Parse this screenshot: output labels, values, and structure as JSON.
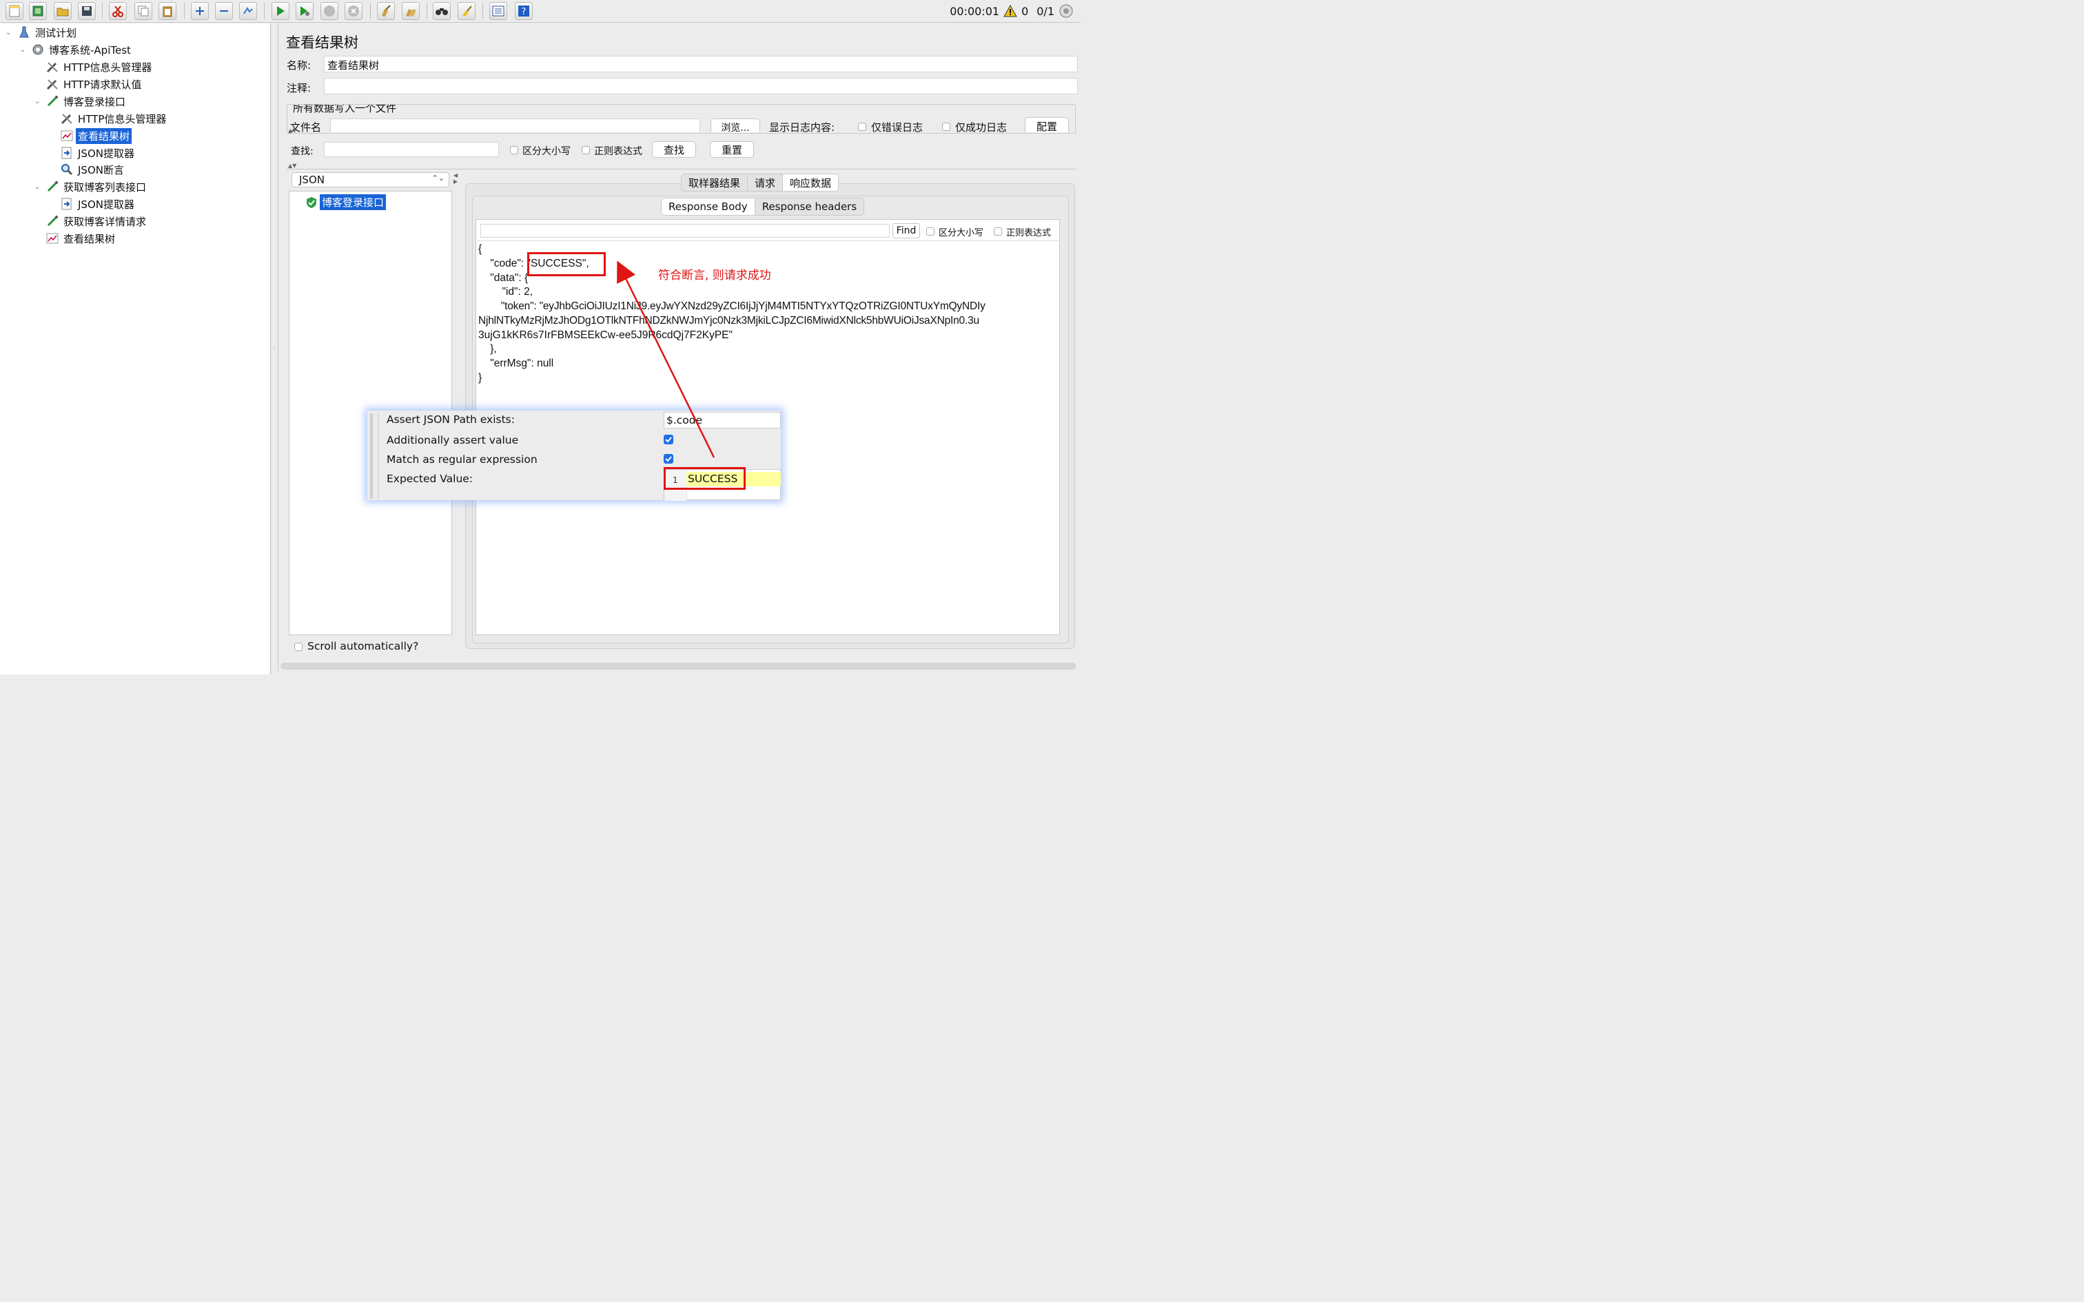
{
  "toolbar": {
    "icons": [
      "new-icon",
      "templates-icon",
      "open-icon",
      "save-icon",
      "cut-icon",
      "copy-icon",
      "paste-icon",
      "expand-icon",
      "collapse-icon",
      "toggle-icon",
      "start-icon",
      "start-no-pause-icon",
      "stop-icon",
      "shutdown-icon",
      "clear-icon",
      "clear-all-icon",
      "search-icon",
      "reset-search-icon",
      "function-helper-icon",
      "help-icon"
    ],
    "timer": "00:00:01",
    "warning_count": "0",
    "threads": "0/1"
  },
  "tree": {
    "items": [
      {
        "label": "测试计划",
        "icon": "flask-icon"
      },
      {
        "label": "博客系统-ApiTest",
        "icon": "gear-icon"
      },
      {
        "label": "HTTP信息头管理器",
        "icon": "wrench-icon"
      },
      {
        "label": "HTTP请求默认值",
        "icon": "wrench-icon"
      },
      {
        "label": "博客登录接口",
        "icon": "pipette-icon"
      },
      {
        "label": "HTTP信息头管理器",
        "icon": "wrench-icon"
      },
      {
        "label": "查看结果树",
        "icon": "chart-icon"
      },
      {
        "label": "JSON提取器",
        "icon": "extractor-icon"
      },
      {
        "label": "JSON断言",
        "icon": "magnifier-icon"
      },
      {
        "label": "获取博客列表接口",
        "icon": "pipette-icon"
      },
      {
        "label": "JSON提取器",
        "icon": "extractor-icon"
      },
      {
        "label": "获取博客详情请求",
        "icon": "pipette-icon"
      },
      {
        "label": "查看结果树",
        "icon": "chart-icon"
      }
    ]
  },
  "panel": {
    "title": "查看结果树",
    "name_label": "名称:",
    "name_value": "查看结果树",
    "comment_label": "注释:",
    "comment_value": "",
    "file_section_title": "所有数据写入一个文件",
    "filename_label": "文件名",
    "browse_button": "浏览...",
    "log_display_label": "显示日志内容:",
    "errors_only_label": "仅错误日志",
    "success_only_label": "仅成功日志",
    "configure_button": "配置",
    "search_label": "查找:",
    "search_value": "",
    "case_sensitive_label": "区分大小写",
    "regex_label": "正则表达式",
    "find_button": "查找",
    "reset_button": "重置",
    "renderer_select": "JSON",
    "result_item": "博客登录接口",
    "result_tabs": [
      "取样器结果",
      "请求",
      "响应数据"
    ],
    "active_result_tab": "响应数据",
    "response_tabs": [
      "Response Body",
      "Response headers"
    ],
    "active_response_tab": "Response Body",
    "response_find_value": "",
    "response_find_button": "Find",
    "response_case_label": "区分大小写",
    "response_regex_label": "正则表达式",
    "scroll_auto_label": "Scroll automatically?"
  },
  "response_body": {
    "lines": [
      "{",
      "    \"code\": \"SUCCESS\",",
      "    \"data\": {",
      "        \"id\": 2,",
      "        \"token\": \"eyJhbGciOiJIUzI1NiJ9.eyJwYXNzd29yZCI6IjJjYjM4MTI5NTYxYTQzOTRiZGI0NTUxYmQyNDIy",
      "NjhlNTkyMzRjMzJhODg1OTlkNTFhNDZkNWJmYjc0Nzk3MjkiLCJpZCI6MiwidXNlck5hbWUiOiJsaXNpIn0.3u",
      "3ujG1kKR6s7IrFBMSEEkCw-ee5J9R6cdQj7F2KyPE\"",
      "    },",
      "    \"errMsg\": null",
      "}"
    ]
  },
  "annotation": {
    "text": "符合断言, 则请求成功",
    "color": "#e01414"
  },
  "assertion_overlay": {
    "path_label": "Assert JSON Path exists:",
    "path_value": "$.code",
    "assert_value_label": "Additionally assert value",
    "assert_value_checked": true,
    "regex_label": "Match as regular expression",
    "regex_checked": true,
    "expected_label": "Expected Value:",
    "expected_line_no": "1",
    "expected_value": "SUCCESS"
  },
  "colors": {
    "selection": "#1a64d6",
    "highlight_red": "#e01414",
    "checkbox_blue": "#1f6fe5",
    "expected_highlight": "#ffff9e"
  }
}
